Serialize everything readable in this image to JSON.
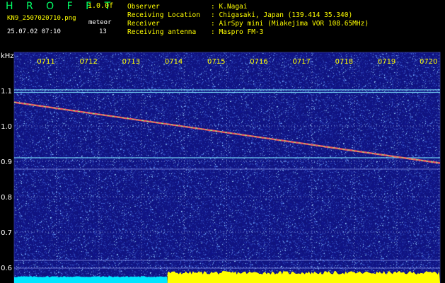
{
  "header": {
    "app_title": "H R O F F T",
    "version": "1.0.0f",
    "file_name": "KN9_2507020710.png",
    "meteor_label": "meteor",
    "meteor_count": "13",
    "date_time": "25.07.02 07:10"
  },
  "info": [
    {
      "label": "Observer",
      "value": ": K.Nagai"
    },
    {
      "label": "Receiving Location",
      "value": ": Chigasaki, Japan (139.414 35.340)"
    },
    {
      "label": "Receiver",
      "value": ": AirSpy mini (Miakejima VOR 108.65MHz)"
    },
    {
      "label": "Receiving antenna",
      "value": ": Maspro FM-3"
    }
  ],
  "axis": {
    "unit": "kHz",
    "y_ticks": [
      "1.1",
      "1.0",
      "0.9",
      "0.8",
      "0.7",
      "0.6"
    ],
    "y_values": [
      1.1,
      1.0,
      0.9,
      0.8,
      0.7,
      0.6
    ],
    "x_ticks": [
      "0711",
      "0712",
      "0713",
      "0714",
      "0715",
      "0716",
      "0717",
      "0718",
      "0719",
      "0720"
    ],
    "freq_range": [
      0.575,
      1.2
    ]
  },
  "signals": {
    "meteor_trail": {
      "freq_start": 1.067,
      "freq_end": 0.895
    },
    "carrier_lines": [
      1.102,
      1.095,
      0.91,
      0.878,
      0.62,
      0.598
    ],
    "mark_colors": {
      "before": "#00e5ff",
      "after": "#ffff00"
    }
  },
  "colors": {
    "background": "#10147a",
    "grid": "#6f79c8",
    "label_green": "#00ff66",
    "label_yellow": "#ffff00",
    "label_white": "#ffffff"
  }
}
